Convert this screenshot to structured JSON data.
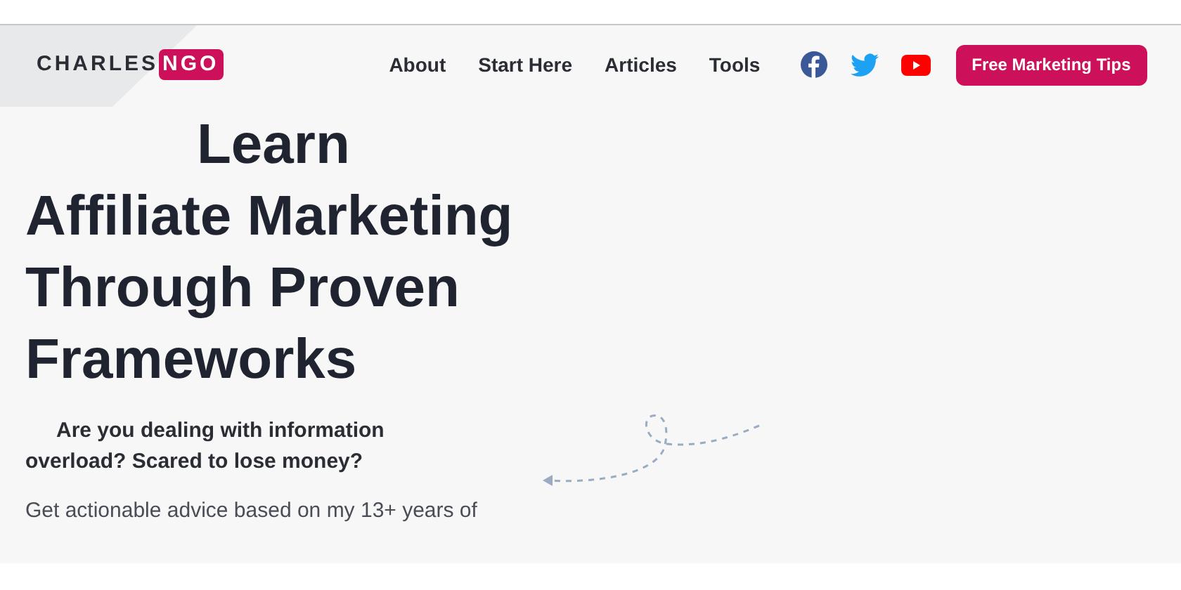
{
  "logo": {
    "first": "CHARLES",
    "second": "NGO"
  },
  "nav": [
    {
      "label": "About"
    },
    {
      "label": "Start Here"
    },
    {
      "label": "Articles"
    },
    {
      "label": "Tools"
    }
  ],
  "social": [
    {
      "kind": "facebook"
    },
    {
      "kind": "twitter"
    },
    {
      "kind": "youtube"
    }
  ],
  "cta_button": "Free Marketing Tips",
  "hero": {
    "heading_lines": [
      "Learn",
      "Affiliate Marketing",
      "Through Proven",
      "Frameworks"
    ],
    "subheading": "Are you dealing with information overload? Scared to lose money?",
    "body": "Get actionable advice based on my 13+ years of"
  }
}
